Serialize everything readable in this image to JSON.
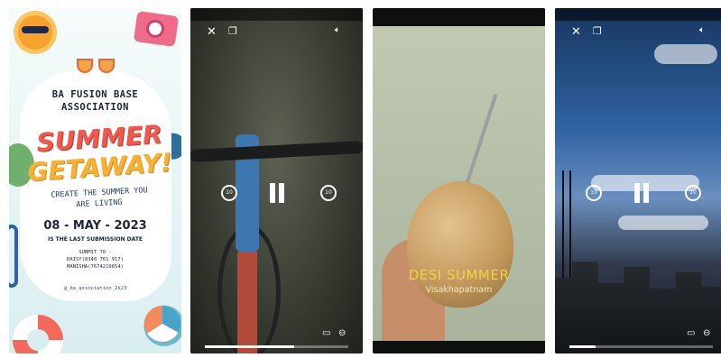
{
  "poster": {
    "title_line1": "BA FUSION BASE",
    "title_line2": "ASSOCIATION",
    "headline1": "SUMMER",
    "headline2": "GETAWAY!",
    "tagline1": "CREATE THE SUMMER YOU",
    "tagline2": "ARE LIVING",
    "date": "08 - MAY - 2023",
    "deadline_note": "IS THE LAST SUBMISSION DATE",
    "submit_label": "SUBMIT TO -",
    "contact1": "DAISY(8340 761 917)",
    "contact2": "MANISHA(7674219654)",
    "handle": "@_ba_association_2k23"
  },
  "video_bike": {
    "skip_back_label": "10",
    "skip_fwd_label": "10",
    "progress": 0.62
  },
  "video_coconut": {
    "title": "DESI SUMMER",
    "subtitle": "Visakhapatnam"
  },
  "video_sky": {
    "skip_back_label": "10",
    "skip_fwd_label": "10",
    "progress": 0.18
  },
  "icons": {
    "close": "close-icon",
    "pip": "picture-in-picture-icon",
    "volume": "volume-icon",
    "cast": "cast-icon",
    "minus": "minus-circle-icon"
  }
}
